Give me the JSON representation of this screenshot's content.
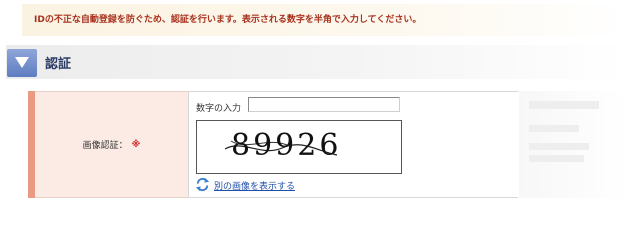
{
  "notice": {
    "text": "IDの不正な自動登録を防ぐため、認証を行います。表示される数字を半角で入力してください。"
  },
  "section": {
    "title": "認証",
    "toggle_icon": "triangle-down-icon"
  },
  "form": {
    "label": "画像認証：",
    "required_mark": "※",
    "input_label": "数字の入力",
    "input_value": "",
    "captcha_text": "89926",
    "refresh_icon": "refresh-icon",
    "refresh_link": "別の画像を表示する"
  },
  "colors": {
    "notice_text": "#a8321f",
    "required": "#cc2222",
    "link": "#1f4fa8",
    "label_bg": "#fcebe4",
    "stripe": "#ea9a83",
    "toggle": "#5e7dc2"
  }
}
